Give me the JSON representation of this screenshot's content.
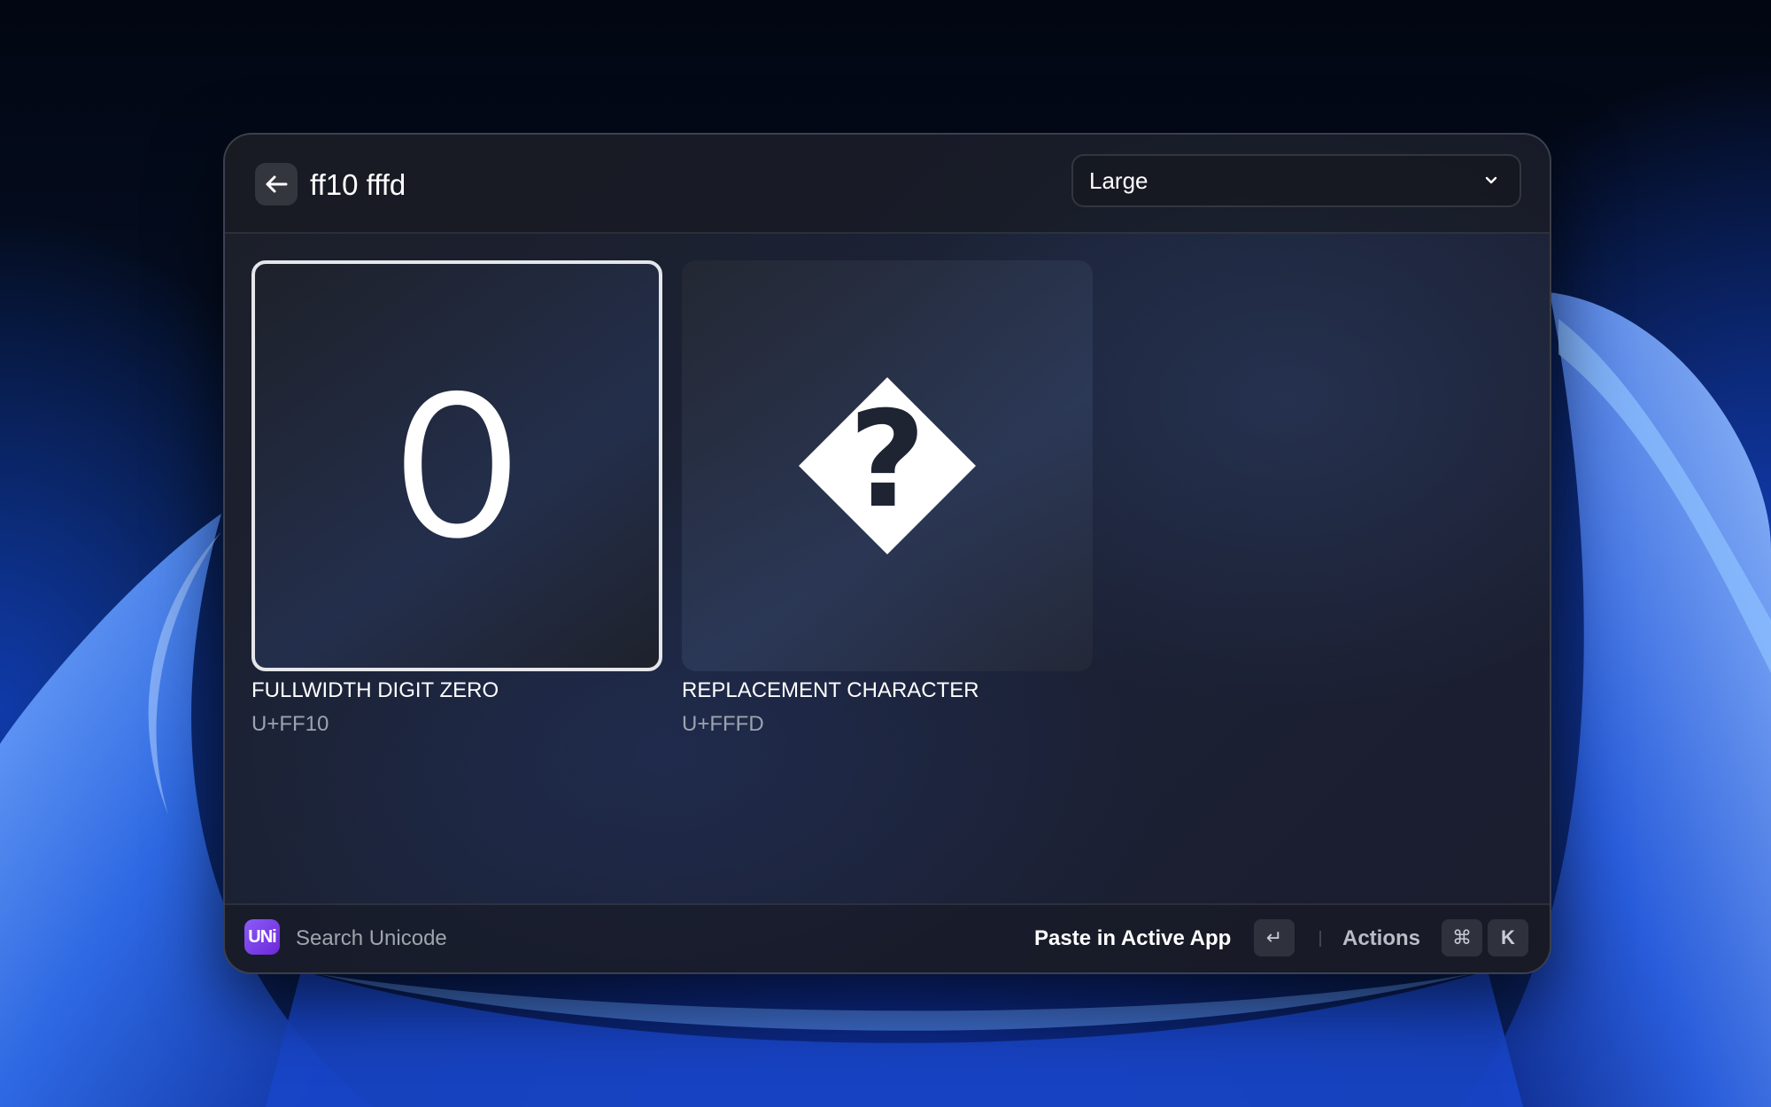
{
  "header": {
    "back_icon": "arrow-left-icon",
    "search_value": "ff10 fffd",
    "size_dropdown": {
      "selected": "Large",
      "icon": "chevron-down-icon"
    }
  },
  "results": [
    {
      "glyph": "０",
      "name": "FULLWIDTH DIGIT ZERO",
      "code": "U+FF10",
      "selected": true
    },
    {
      "glyph": "�",
      "name": "REPLACEMENT CHARACTER",
      "code": "U+FFFD",
      "selected": false
    }
  ],
  "footer": {
    "logo_text": "UNi",
    "title": "Search Unicode",
    "primary_action": "Paste in Active App",
    "primary_shortcut": "↵",
    "actions_label": "Actions",
    "actions_shortcut_mod": "⌘",
    "actions_shortcut_key": "K"
  },
  "colors": {
    "window_border": "#2b2f3a",
    "selection_border": "#e4e6ea",
    "logo_gradient_start": "#8b5cf6",
    "logo_gradient_end": "#6d28d9"
  }
}
